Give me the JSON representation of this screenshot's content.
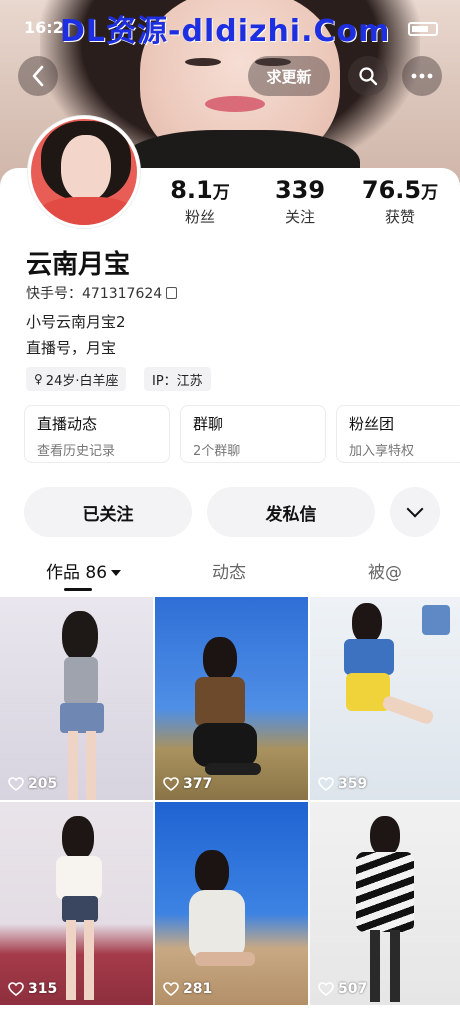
{
  "watermark": "DL资源-dldizhi.Com",
  "status": {
    "time": "16:2"
  },
  "header": {
    "update_label": "求更新",
    "back_icon": "back-arrow-icon",
    "search_icon": "search-icon",
    "more_icon": "more-dots-icon"
  },
  "profile": {
    "name": "云南月宝",
    "kuaishou_id": "快手号：471317624",
    "bio_line1": "小号云南月宝2",
    "bio_line2": "直播号，月宝",
    "tag_age": "24岁·白羊座",
    "tag_ip": "IP：江苏",
    "stats": [
      {
        "num": "8.1",
        "unit": "万",
        "label": "粉丝"
      },
      {
        "num": "339",
        "unit": "",
        "label": "关注"
      },
      {
        "num": "76.5",
        "unit": "万",
        "label": "获赞"
      }
    ]
  },
  "features": [
    {
      "title": "直播动态",
      "sub": "查看历史记录"
    },
    {
      "title": "群聊",
      "sub": "2个群聊"
    },
    {
      "title": "粉丝团",
      "sub": "加入享特权"
    }
  ],
  "actions": {
    "followed": "已关注",
    "message": "发私信"
  },
  "tabs": {
    "works": "作品 86",
    "dynamic": "动态",
    "mentioned": "被@"
  },
  "posts": [
    {
      "likes": "205"
    },
    {
      "likes": "377"
    },
    {
      "likes": "359"
    },
    {
      "likes": "315"
    },
    {
      "likes": "281"
    },
    {
      "likes": "507"
    }
  ]
}
